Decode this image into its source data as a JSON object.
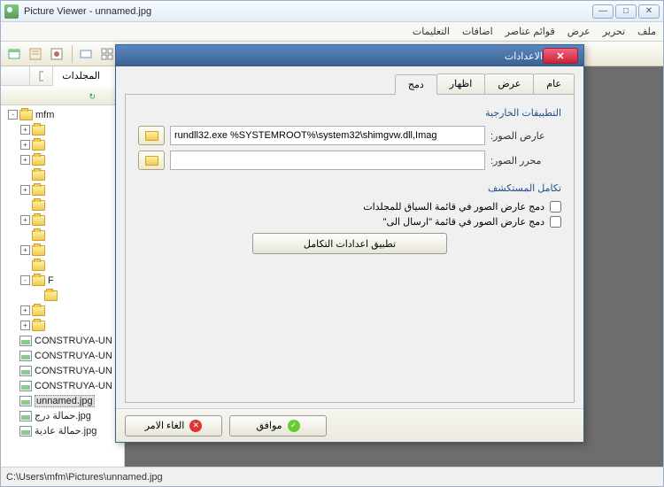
{
  "window": {
    "title": "Picture Viewer - unnamed.jpg"
  },
  "menu": {
    "items": [
      "ملف",
      "تحرير",
      "عرض",
      "قوائم عناصر",
      "اضافات",
      "التعليمات"
    ]
  },
  "sidebar": {
    "tab_folders": "المجلدات",
    "tree": [
      {
        "indent": 0,
        "type": "folder",
        "twist": "-",
        "label": "mfm"
      },
      {
        "indent": 1,
        "type": "folder",
        "twist": "+",
        "label": ""
      },
      {
        "indent": 1,
        "type": "folder",
        "twist": "+",
        "label": ""
      },
      {
        "indent": 1,
        "type": "folder",
        "twist": "+",
        "label": ""
      },
      {
        "indent": 1,
        "type": "folder",
        "twist": "",
        "label": ""
      },
      {
        "indent": 1,
        "type": "folder",
        "twist": "+",
        "label": ""
      },
      {
        "indent": 1,
        "type": "folder",
        "twist": "",
        "label": ""
      },
      {
        "indent": 1,
        "type": "folder",
        "twist": "+",
        "label": ""
      },
      {
        "indent": 1,
        "type": "folder",
        "twist": "",
        "label": ""
      },
      {
        "indent": 1,
        "type": "folder",
        "twist": "+",
        "label": ""
      },
      {
        "indent": 1,
        "type": "folder",
        "twist": "",
        "label": ""
      },
      {
        "indent": 1,
        "type": "folder",
        "twist": "-",
        "label": "F"
      },
      {
        "indent": 2,
        "type": "folder",
        "twist": "",
        "label": ""
      },
      {
        "indent": 1,
        "type": "folder",
        "twist": "+",
        "label": ""
      },
      {
        "indent": 1,
        "type": "folder",
        "twist": "+",
        "label": ""
      },
      {
        "indent": 0,
        "type": "pic",
        "twist": "",
        "label": "CONSTRUYA-UN"
      },
      {
        "indent": 0,
        "type": "pic",
        "twist": "",
        "label": "CONSTRUYA-UN"
      },
      {
        "indent": 0,
        "type": "pic",
        "twist": "",
        "label": "CONSTRUYA-UN"
      },
      {
        "indent": 0,
        "type": "pic",
        "twist": "",
        "label": "CONSTRUYA-UN"
      },
      {
        "indent": 0,
        "type": "pic",
        "twist": "",
        "label": "unnamed.jpg",
        "sel": true
      },
      {
        "indent": 0,
        "type": "pic",
        "twist": "",
        "label": "حمالة درج.jpg"
      },
      {
        "indent": 0,
        "type": "pic",
        "twist": "",
        "label": "حمالة عادية.jpg"
      }
    ]
  },
  "dialog": {
    "title": "الاعدادات",
    "tabs": {
      "general": "عام",
      "view": "عرض",
      "show": "اظهار",
      "integrate": "دمج"
    },
    "group_ext": "التطبيقات الخارجية",
    "field_viewer": "عارض الصور:",
    "field_editor": "محرر الصور:",
    "viewer_value": "rundll32.exe %SYSTEMROOT%\\system32\\shimgvw.dll,Imag",
    "editor_value": "",
    "group_explorer": "تكامل المستكشف",
    "check_context": "دمج عارض الصور في قائمة السياق للمجلدات",
    "check_sendto": "دمج عارض الصور في قائمة \"ارسال الى\"",
    "apply_btn": "تطبيق اعدادات التكامل",
    "ok": "موافق",
    "cancel": "الغاء الامر"
  },
  "status": {
    "path": "C:\\Users\\mfm\\Pictures\\unnamed.jpg"
  }
}
